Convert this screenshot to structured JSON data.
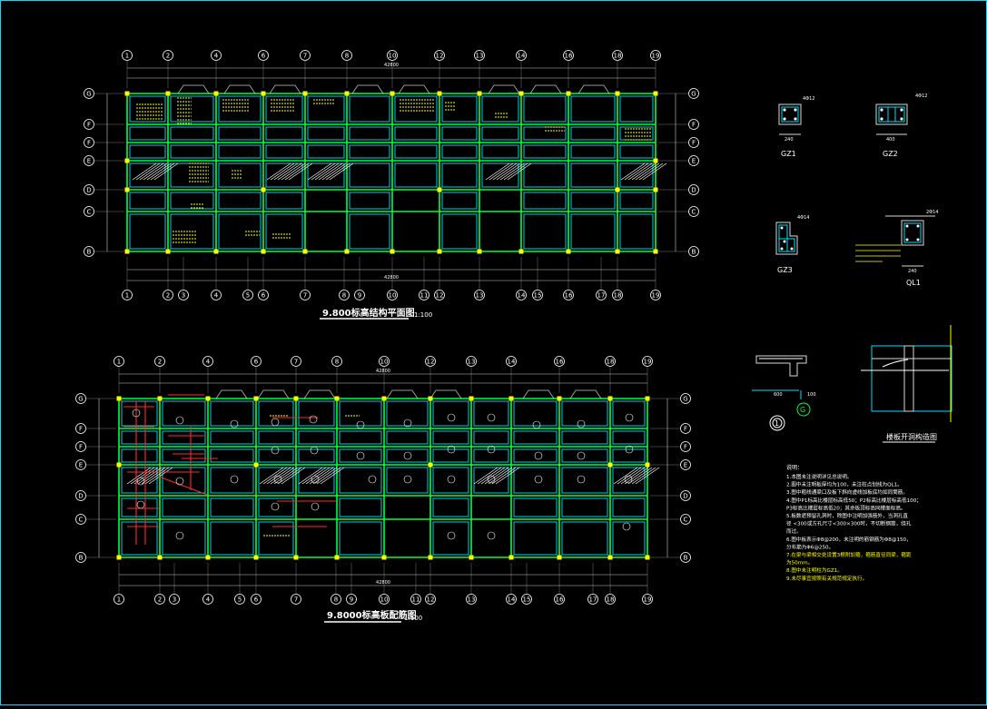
{
  "plans": {
    "top": {
      "title": "9.800标高结构平面图",
      "scale": "1:100",
      "total_dim": "42800",
      "axes_top": [
        "1",
        "2",
        "4",
        "6",
        "7",
        "8",
        "10",
        "12",
        "13",
        "14",
        "16",
        "18",
        "19"
      ],
      "axes_bottom": [
        "1",
        "2",
        "3",
        "4",
        "5",
        "6",
        "7",
        "8",
        "9",
        "10",
        "11",
        "12",
        "13",
        "14",
        "15",
        "16",
        "17",
        "18",
        "19"
      ],
      "rows": [
        "G",
        "F",
        "F",
        "E",
        "D",
        "C",
        "B"
      ]
    },
    "bottom": {
      "title": "9.8000标高板配筋图",
      "scale": "1:100",
      "total_dim": "42800",
      "axes_top": [
        "1",
        "2",
        "4",
        "6",
        "7",
        "8",
        "10",
        "12",
        "13",
        "14",
        "16",
        "18",
        "19"
      ],
      "axes_bottom": [
        "1",
        "2",
        "3",
        "4",
        "5",
        "6",
        "7",
        "8",
        "9",
        "10",
        "11",
        "12",
        "13",
        "14",
        "15",
        "16",
        "17",
        "18",
        "19"
      ],
      "rows": [
        "G",
        "F",
        "F",
        "E",
        "D",
        "C",
        "B"
      ]
    }
  },
  "details": {
    "gz1": "GZ1",
    "gz2": "GZ2",
    "gz3": "GZ3",
    "ql1": "QL1",
    "gz1_rebar": "4Φ12",
    "gz2_rebar": "4Φ12",
    "gz3_rebar": "4Φ14",
    "ql1_rebar": "2Φ14",
    "dim_240": "240",
    "dim_400": "400",
    "section_no": "1",
    "axis_g": "G",
    "detail_title": "楼板开洞构造图",
    "dim_600": "600",
    "dim_100": "100"
  },
  "notes": {
    "heading": "说明：",
    "lines": [
      "1.本图未注说明详见总说明。",
      "2.图中未注明板厚均为100，未注柱点划线为QL1。",
      "3.图中粗线通梁口及板下斜向虚线加板底均如同筒筋。",
      "4.图中P1标高比楼层标高低50；P2标高比楼层标高低100；",
      "  P3标高比楼层标高低20；其余板顶标高同楼面标高。",
      "5.板数遮预留孔洞时，除图中注明加强筋外，当洞孔直",
      "  径 <300或方孔尺寸<300×300时，不切断钢筋，绕孔",
      "  而过。",
      "6.图中板表示Φ8@200，未注明的筋钢筋为Φ8@150，",
      "  分布筋为Φ6@250。",
      "7.在梁与梁相交处设置3根附加箍，箍筋直径同梁，箍距",
      "  为50mm。",
      "8.图中未注明柱为GZ1。",
      "9.未尽事宜按照有关规范规定执行。"
    ]
  }
}
